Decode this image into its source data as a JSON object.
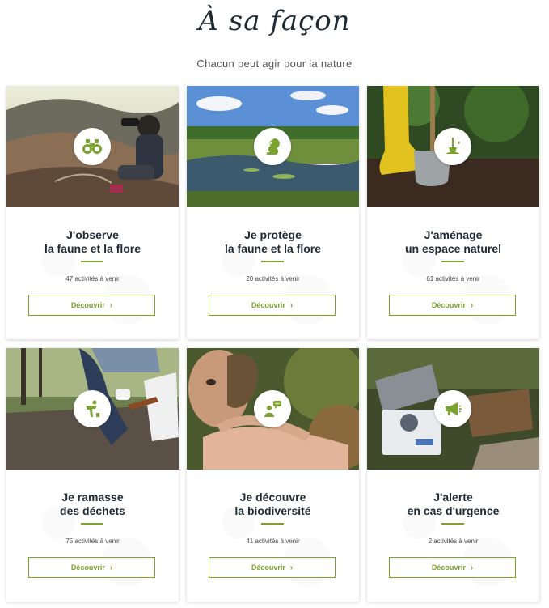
{
  "header": {
    "title": "À sa façon",
    "subtitle": "Chacun peut agir pour la nature"
  },
  "accent_color": "#7aa32f",
  "cards": [
    {
      "line1": "J'observe",
      "line2": "la faune et la flore",
      "count": "47 activités à venir",
      "button": "Découvrir",
      "icon": "binoculars-icon"
    },
    {
      "line1": "Je protège",
      "line2": "la faune et la flore",
      "count": "20 activités à venir",
      "button": "Découvrir",
      "icon": "squirrel-icon"
    },
    {
      "line1": "J'aménage",
      "line2": "un espace naturel",
      "count": "61 activités à venir",
      "button": "Découvrir",
      "icon": "gardening-icon"
    },
    {
      "line1": "Je ramasse",
      "line2": "des déchets",
      "count": "75 activités à venir",
      "button": "Découvrir",
      "icon": "pick-up-trash-icon"
    },
    {
      "line1": "Je découvre",
      "line2": "la biodiversité",
      "count": "41 activités à venir",
      "button": "Découvrir",
      "icon": "discover-person-icon"
    },
    {
      "line1": "J'alerte",
      "line2": "en cas d'urgence",
      "count": "2 activités à venir",
      "button": "Découvrir",
      "icon": "megaphone-icon"
    }
  ]
}
